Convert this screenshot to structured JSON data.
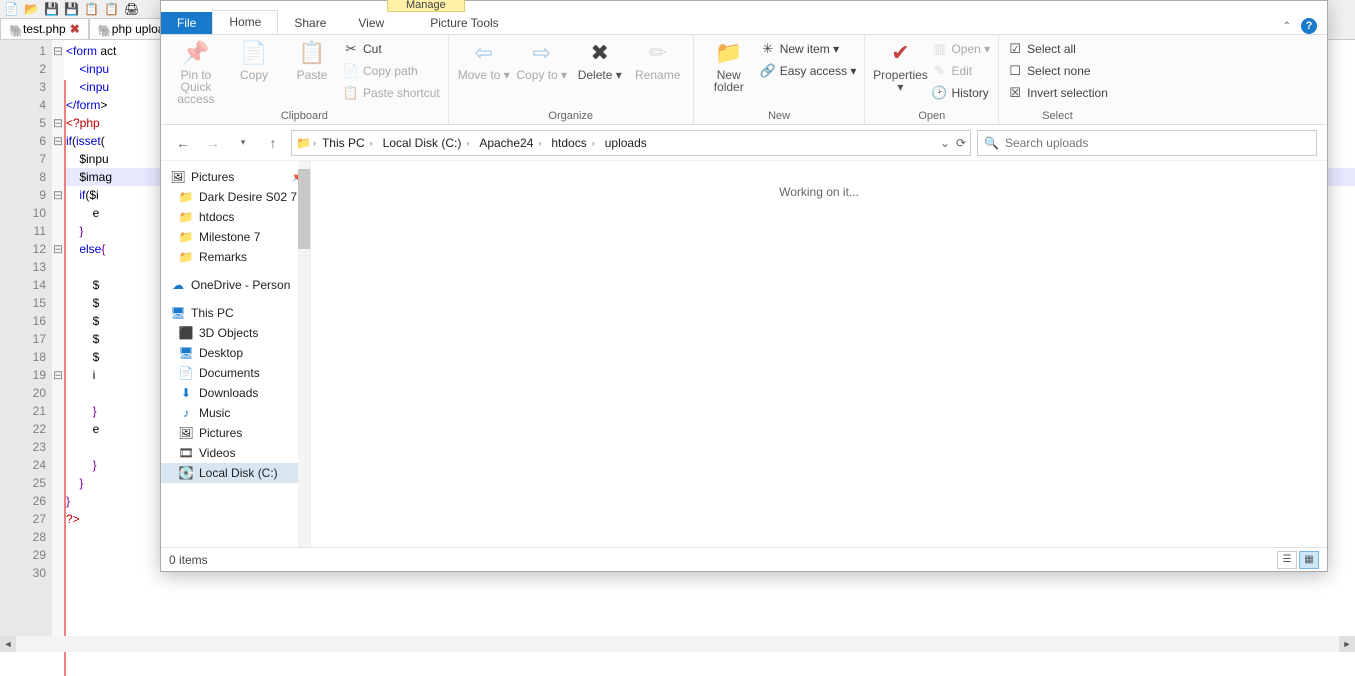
{
  "editor": {
    "toolbar_icons": [
      "new",
      "open",
      "save",
      "save-all",
      "copy",
      "paste",
      "print"
    ],
    "tabs": [
      {
        "name": "test.php",
        "unsaved": true
      },
      {
        "name": "php upload in",
        "unsaved": false
      }
    ],
    "lines": [
      "<form act",
      "    <inpu",
      "    <inpu",
      "</form>",
      "<?php",
      "if(isset(",
      "    $inpu",
      "    $imag",
      "    if($i",
      "        e",
      "    }",
      "    else{",
      "",
      "        $",
      "        $",
      "        $",
      "        $",
      "        $",
      "        i",
      "",
      "        }",
      "        e",
      "",
      "        }",
      "    }",
      "}",
      "?>",
      "",
      "",
      ""
    ]
  },
  "explorer": {
    "manage_label": "Manage",
    "ribbon_tabs": {
      "file": "File",
      "home": "Home",
      "share": "Share",
      "view": "View",
      "picture_tools": "Picture Tools"
    },
    "ribbon": {
      "clipboard": {
        "label": "Clipboard",
        "pin": "Pin to Quick access",
        "copy": "Copy",
        "paste": "Paste",
        "cut": "Cut",
        "copy_path": "Copy path",
        "paste_shortcut": "Paste shortcut"
      },
      "organize": {
        "label": "Organize",
        "move_to": "Move to",
        "copy_to": "Copy to",
        "delete": "Delete",
        "rename": "Rename"
      },
      "new": {
        "label": "New",
        "new_folder": "New folder",
        "new_item": "New item",
        "easy_access": "Easy access"
      },
      "open": {
        "label": "Open",
        "properties": "Properties",
        "open": "Open",
        "edit": "Edit",
        "history": "History"
      },
      "select": {
        "label": "Select",
        "select_all": "Select all",
        "select_none": "Select none",
        "invert": "Invert selection"
      }
    },
    "breadcrumb": [
      "This PC",
      "Local Disk (C:)",
      "Apache24",
      "htdocs",
      "uploads"
    ],
    "search_placeholder": "Search uploads",
    "nav": {
      "quick": [
        {
          "label": "Pictures",
          "icon": "pictures",
          "pinned": true
        },
        {
          "label": "Dark Desire S02 7",
          "icon": "folder"
        },
        {
          "label": "htdocs",
          "icon": "folder"
        },
        {
          "label": "Milestone 7",
          "icon": "folder"
        },
        {
          "label": "Remarks",
          "icon": "folder"
        }
      ],
      "onedrive": "OneDrive - Person",
      "thispc": {
        "label": "This PC",
        "children": [
          {
            "label": "3D Objects",
            "icon": "3d"
          },
          {
            "label": "Desktop",
            "icon": "desktop"
          },
          {
            "label": "Documents",
            "icon": "documents"
          },
          {
            "label": "Downloads",
            "icon": "downloads"
          },
          {
            "label": "Music",
            "icon": "music"
          },
          {
            "label": "Pictures",
            "icon": "pictures"
          },
          {
            "label": "Videos",
            "icon": "videos"
          },
          {
            "label": "Local Disk (C:)",
            "icon": "disk",
            "selected": true
          }
        ]
      }
    },
    "content_status": "Working on it...",
    "status_items": "0 items"
  }
}
